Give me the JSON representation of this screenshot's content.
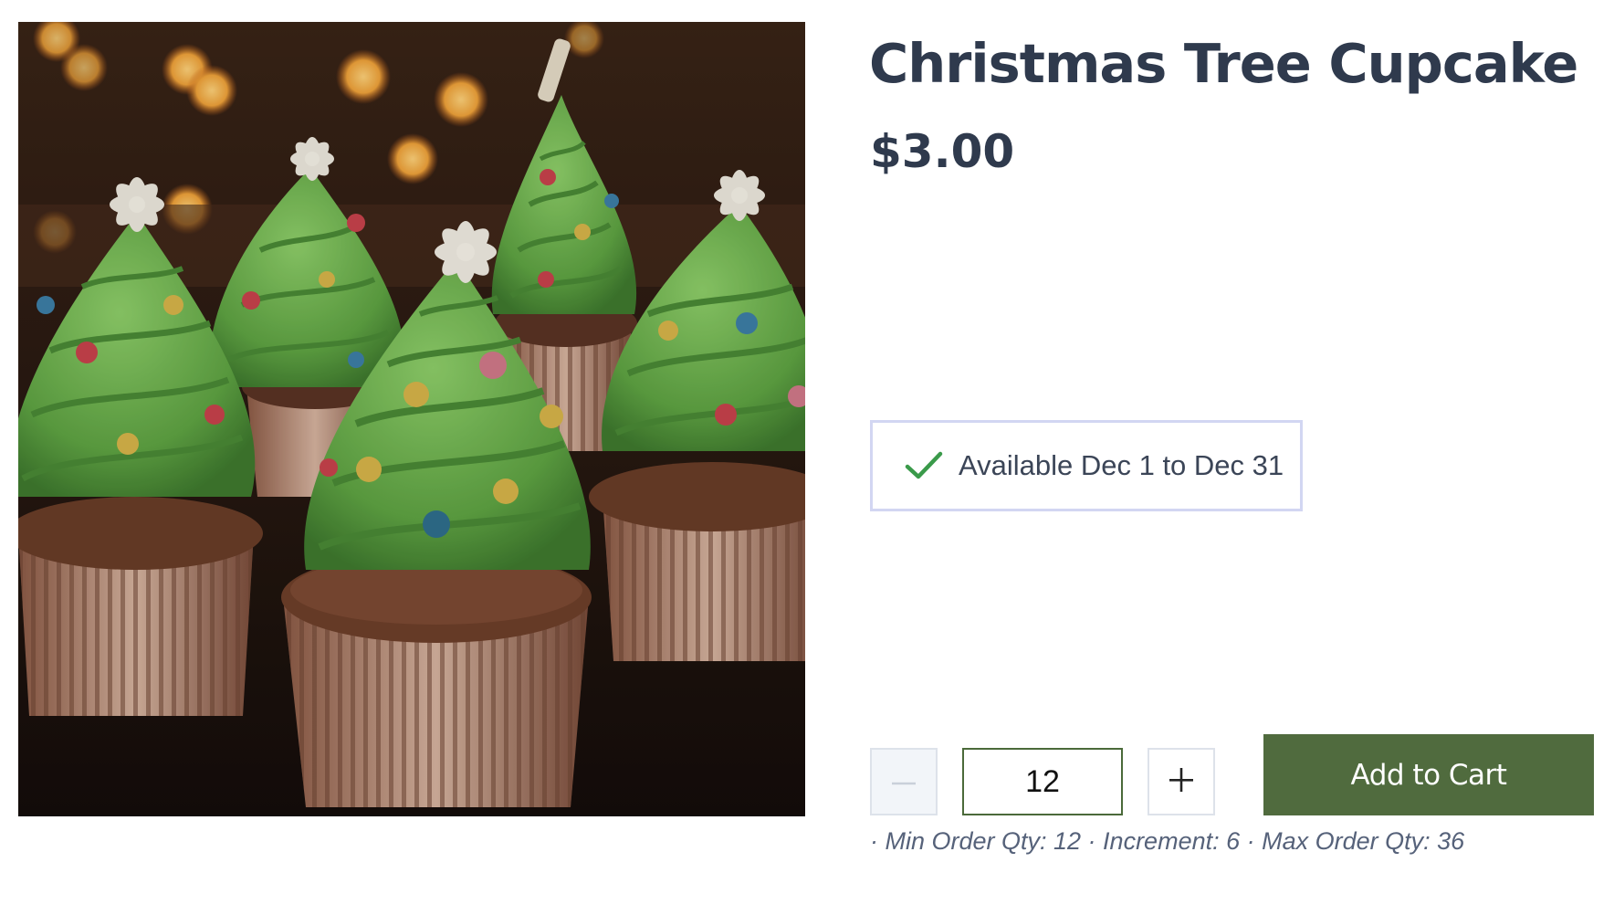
{
  "product": {
    "title": "Christmas Tree Cupcake",
    "price": "$3.00",
    "image_alt": "Christmas tree cupcakes"
  },
  "availability": {
    "icon": "check-icon",
    "text": "Available Dec 1 to Dec 31",
    "icon_color": "#3a9a4a"
  },
  "quantity": {
    "value": "12",
    "decrement_icon": "minus-icon",
    "increment_icon": "plus-icon"
  },
  "cart": {
    "add_label": "Add to Cart",
    "button_color": "#506b3e"
  },
  "order_rules": {
    "text": "· Min Order Qty: 12 · Increment: 6 · Max Order Qty: 36"
  }
}
